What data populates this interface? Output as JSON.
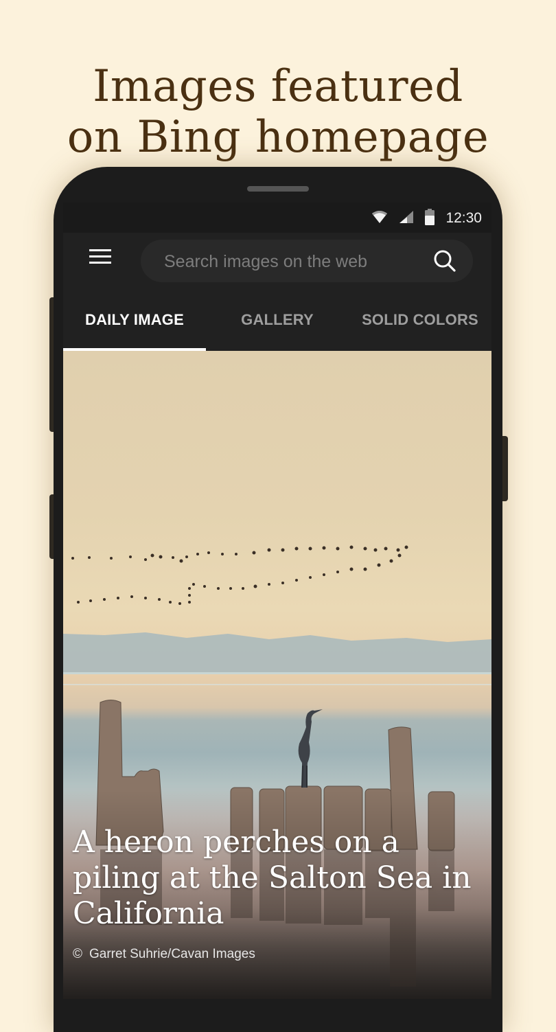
{
  "promo": {
    "title_line1": "Images featured",
    "title_line2": "on Bing homepage"
  },
  "status_bar": {
    "time": "12:30",
    "icons": [
      "wifi-icon",
      "cell-signal-icon",
      "battery-icon"
    ]
  },
  "appbar": {
    "menu_icon": "hamburger-menu-icon",
    "search_placeholder": "Search images on the web",
    "search_value": "",
    "search_icon": "search-icon"
  },
  "tabs": [
    {
      "label": "DAILY IMAGE",
      "active": true
    },
    {
      "label": "GALLERY",
      "active": false
    },
    {
      "label": "SOLID COLORS",
      "active": false
    }
  ],
  "daily_image": {
    "caption": "A heron perches on a piling at the Salton Sea in California",
    "copyright_symbol": "©",
    "credit": "Garret Suhrie/Cavan Images"
  },
  "colors": {
    "background": "#fcf2dc",
    "title_text": "#4a3012",
    "app_dark": "#212121",
    "tab_active": "#ffffff",
    "tab_inactive": "#9e9e9e"
  }
}
